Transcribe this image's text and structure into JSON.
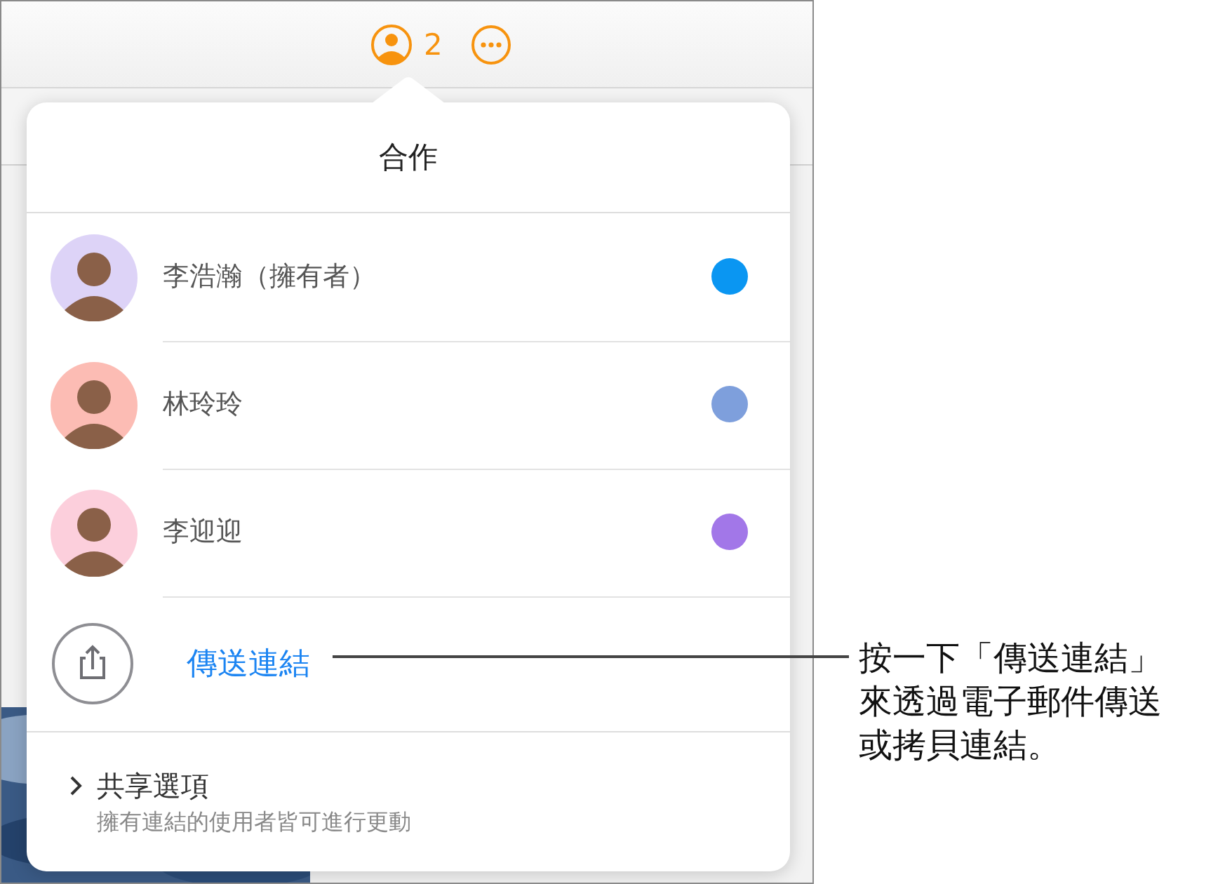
{
  "toolbar": {
    "collaborator_count": "2"
  },
  "popover": {
    "title": "合作",
    "participants": [
      {
        "name": "李浩瀚（擁有者）",
        "color": "#0a96f2"
      },
      {
        "name": "林玲玲",
        "color": "#7e9fdc"
      },
      {
        "name": "李迎迎",
        "color": "#a277e8"
      }
    ],
    "send_link": "傳送連結",
    "share_options": {
      "title": "共享選項",
      "subtitle": "擁有連結的使用者皆可進行更動"
    }
  },
  "callout": {
    "lines": [
      "按一下「傳送連結」",
      "來透過電子郵件傳送",
      "或拷貝連結。"
    ]
  }
}
